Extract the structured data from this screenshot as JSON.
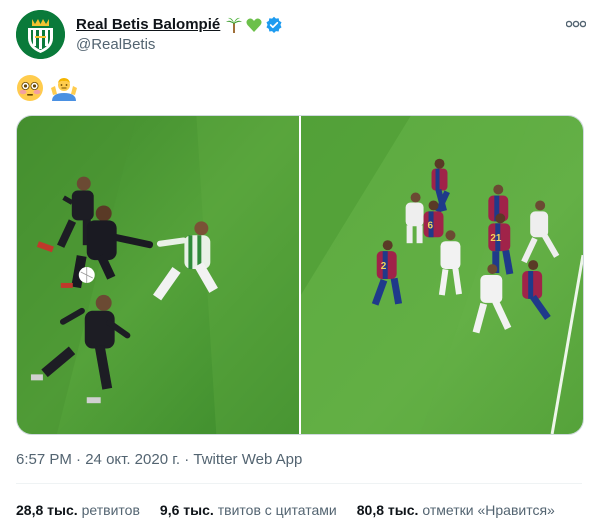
{
  "account": {
    "display_name": "Real Betis Balompié",
    "handle": "@RealBetis",
    "verified": true
  },
  "tweet": {
    "emojis": [
      "flushed-face-emoji",
      "man-shrugging-emoji"
    ],
    "time": "6:57 PM",
    "separator": " · ",
    "date": "24 окт. 2020 г.",
    "source": "Twitter Web App"
  },
  "stats": [
    {
      "count": "28,8 тыс.",
      "label": "ретвитов"
    },
    {
      "count": "9,6 тыс.",
      "label": "твитов с цитатами"
    },
    {
      "count": "80,8 тыс.",
      "label": "отметки «Нравится»"
    }
  ],
  "colors": {
    "accent": "#1d9bf0",
    "pitch_light": "#5aa83f",
    "pitch_dark": "#3f8a2c",
    "betis_green": "#0a7a3a"
  }
}
